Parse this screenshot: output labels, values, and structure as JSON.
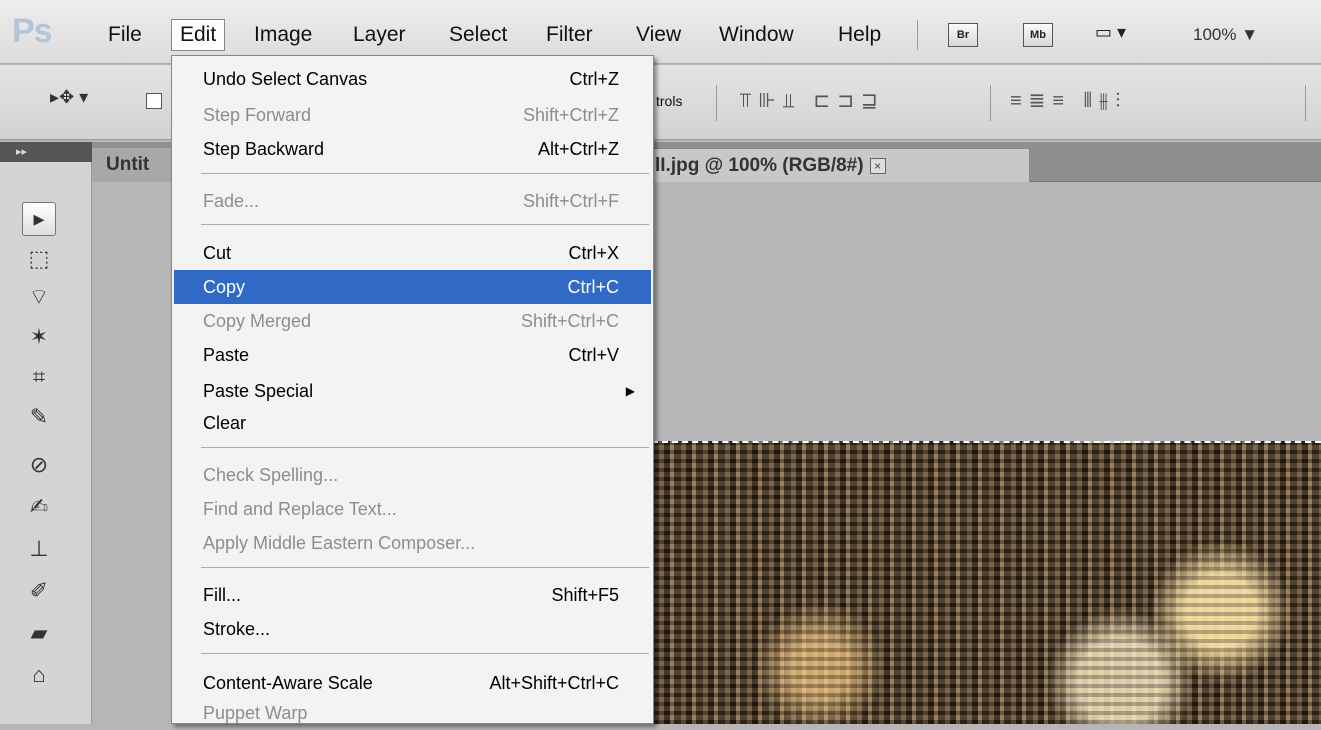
{
  "app": {
    "logo": "Ps"
  },
  "menubar": {
    "items": [
      "File",
      "Edit",
      "Image",
      "Layer",
      "Select",
      "Filter",
      "View",
      "Window",
      "Help"
    ],
    "bridge": "Br",
    "minibridge": "Mb",
    "zoom": "100% ▼"
  },
  "options": {
    "controls_label": "trols"
  },
  "tabs": {
    "untitled": "Untit",
    "main": "lI.jpg @ 100% (RGB/8#)",
    "close": "×"
  },
  "tools_header": "▸▸",
  "edit_menu": {
    "items": [
      {
        "label": "Undo Select Canvas",
        "shortcut": "Ctrl+Z",
        "state": "enabled"
      },
      {
        "label": "Step Forward",
        "shortcut": "Shift+Ctrl+Z",
        "state": "disabled"
      },
      {
        "label": "Step Backward",
        "shortcut": "Alt+Ctrl+Z",
        "state": "enabled"
      },
      {
        "label": "Fade...",
        "shortcut": "Shift+Ctrl+F",
        "state": "disabled"
      },
      {
        "label": "Cut",
        "shortcut": "Ctrl+X",
        "state": "enabled"
      },
      {
        "label": "Copy",
        "shortcut": "Ctrl+C",
        "state": "highlight"
      },
      {
        "label": "Copy Merged",
        "shortcut": "Shift+Ctrl+C",
        "state": "disabled"
      },
      {
        "label": "Paste",
        "shortcut": "Ctrl+V",
        "state": "enabled"
      },
      {
        "label": "Paste Special",
        "shortcut": "",
        "state": "enabled",
        "submenu": true
      },
      {
        "label": "Clear",
        "shortcut": "",
        "state": "enabled"
      },
      {
        "label": "Check Spelling...",
        "shortcut": "",
        "state": "disabled"
      },
      {
        "label": "Find and Replace Text...",
        "shortcut": "",
        "state": "disabled"
      },
      {
        "label": "Apply Middle Eastern Composer...",
        "shortcut": "",
        "state": "disabled"
      },
      {
        "label": "Fill...",
        "shortcut": "Shift+F5",
        "state": "enabled"
      },
      {
        "label": "Stroke...",
        "shortcut": "",
        "state": "enabled"
      },
      {
        "label": "Content-Aware Scale",
        "shortcut": "Alt+Shift+Ctrl+C",
        "state": "enabled"
      },
      {
        "label": "Puppet Warp",
        "shortcut": "",
        "state": "disabled"
      }
    ]
  },
  "colors": {
    "highlight": "#3169c6",
    "disabled_text": "#8d8d8d"
  }
}
